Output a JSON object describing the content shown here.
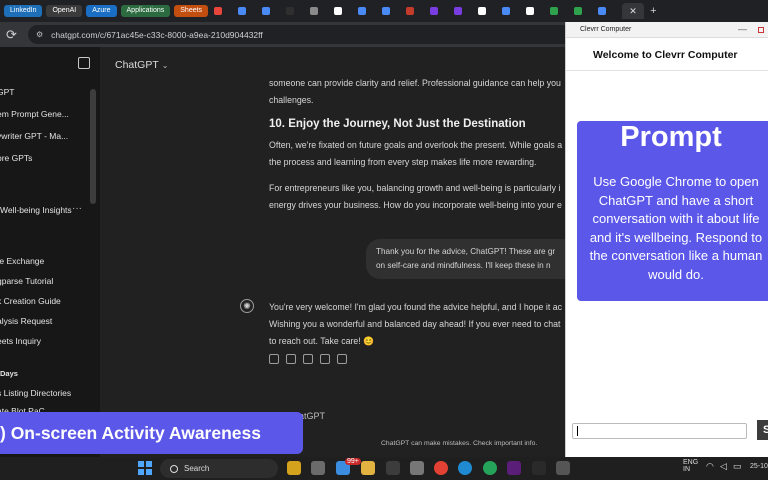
{
  "browser": {
    "bookmarks": [
      {
        "label": "LinkedIn",
        "color": "#1d6fb8"
      },
      {
        "label": "OpenAI",
        "color": "#3b3b3b"
      },
      {
        "label": "Azure",
        "color": "#1a6fc4"
      },
      {
        "label": "Applications",
        "color": "#2b6b3f"
      },
      {
        "label": "Sheets",
        "color": "#c24e10"
      }
    ],
    "tab_favicons": [
      "#e8453c",
      "#4a8af4",
      "#4a8af4",
      "#2f2f2f",
      "#8a8a8a",
      "#ffffff",
      "#4a8af4",
      "#4a8af4",
      "#c23b2b",
      "#7a3de1",
      "#7a3de1",
      "#ffffff",
      "#4a8af4",
      "#ffffff",
      "#2fa24d",
      "#2fa24d",
      "#4a8af4"
    ],
    "url": "chatgpt.com/c/671ac45e-c33c-8000-a9ea-210d904432ff",
    "new_tab": "+",
    "close_tab": "✕"
  },
  "sidebar": {
    "items": [
      {
        "label": "GPT",
        "top": 0
      },
      {
        "label": "em Prompt Gene...",
        "top": 0
      },
      {
        "label": "ywriter GPT - Ma...",
        "top": 0
      },
      {
        "label": "ore GPTs",
        "top": 0
      }
    ],
    "chats": [
      "Well-being Insights",
      "te Exchange",
      "gparse Tutorial",
      "k Creation Guide",
      "alysis Request",
      "eets Inquiry"
    ],
    "more": "···",
    "section": "Days",
    "older": [
      "s Listing Directories",
      "ate Blot PaC..."
    ]
  },
  "chat": {
    "model": "ChatGPT",
    "p1": [
      "someone can provide clarity and relief. Professional guidance can help you",
      "challenges."
    ],
    "heading_num": "10.",
    "heading": "Enjoy the Journey, Not Just the Destination",
    "p2": [
      "Often, we're fixated on future goals and overlook the present. While goals a",
      "the process and learning from every step makes life more rewarding."
    ],
    "p3": [
      "For entrepreneurs like you, balancing growth and well-being is particularly i",
      "energy drives your business. How do you incorporate well-being into your e"
    ],
    "user": [
      "Thank you for the advice, ChatGPT! These are gr",
      "on self-care and mindfulness. I'll keep these in n"
    ],
    "reply": [
      "You're very welcome! I'm glad you found the advice helpful, and I hope it ac",
      "Wishing you a wonderful and balanced day ahead! If you ever need to chat",
      "to reach out. Take care! 😊"
    ],
    "composer": "e ChatGPT",
    "disclaimer": "ChatGPT can make mistakes. Check important info."
  },
  "overlay": {
    "window_title": "Clevrr Computer",
    "welcome": "Welcome to Clevrr Computer",
    "prompt_title": "Prompt",
    "prompt_text": "Use Google Chrome to open ChatGPT and have a short conversation with it about life and it's wellbeing. Respond to the conversation like a human would do.",
    "send_label": "S"
  },
  "banner": ") On-screen Activity Awareness",
  "taskbar": {
    "search": "Search",
    "lang": [
      "ENG",
      "IN"
    ],
    "time": "25-10",
    "badge": "99+"
  }
}
